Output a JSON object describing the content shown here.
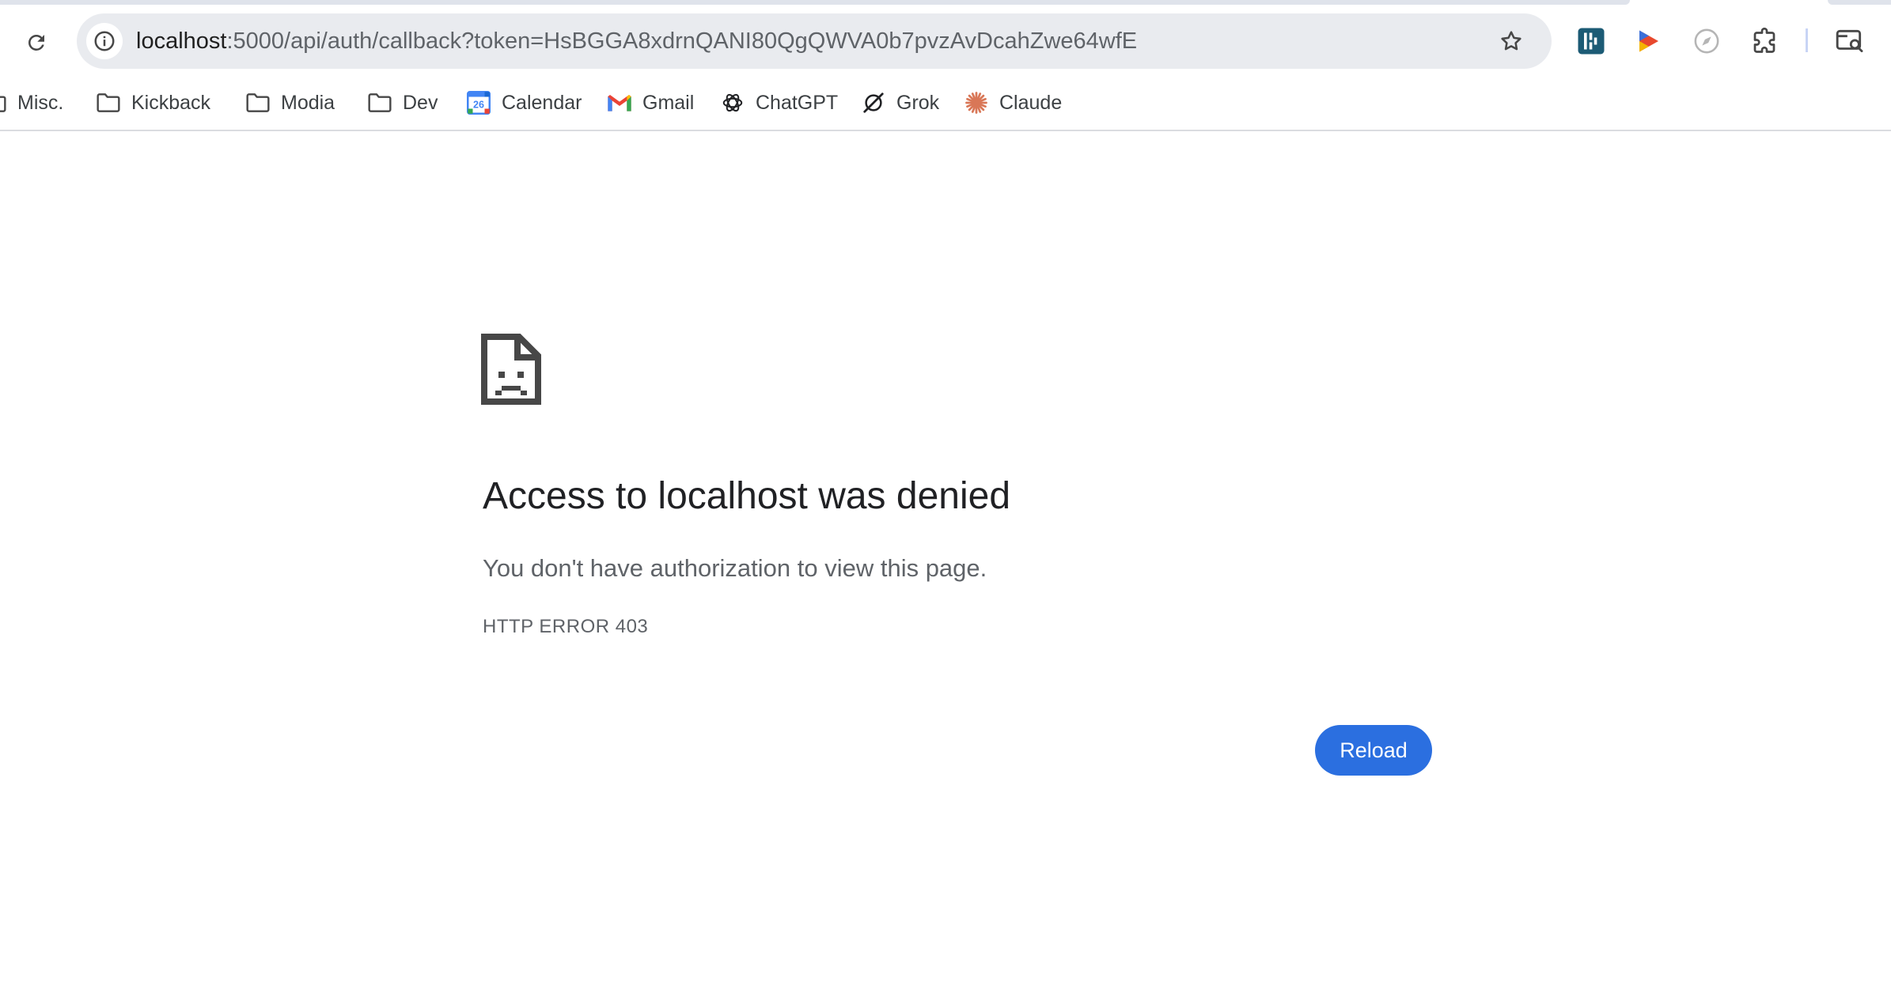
{
  "browser": {
    "address_bar": {
      "url_host": "localhost",
      "url_rest": ":5000/api/auth/callback?token=HsBGGA8xdrnQANI80QgQWVA0b7pvzAvDcahZwe64wfE"
    },
    "bookmarks": [
      {
        "label": "Misc.",
        "icon": "folder-icon"
      },
      {
        "label": "Kickback",
        "icon": "folder-icon"
      },
      {
        "label": "Modia",
        "icon": "folder-icon"
      },
      {
        "label": "Dev",
        "icon": "folder-icon"
      },
      {
        "label": "Calendar",
        "icon": "google-calendar-icon",
        "badge": "26"
      },
      {
        "label": "Gmail",
        "icon": "gmail-icon"
      },
      {
        "label": "ChatGPT",
        "icon": "chatgpt-icon"
      },
      {
        "label": "Grok",
        "icon": "grok-icon"
      },
      {
        "label": "Claude",
        "icon": "claude-icon"
      }
    ],
    "extensions": [
      "extension-teal-icon",
      "extension-play-icon",
      "extension-compass-icon",
      "extensions-puzzle-icon",
      "tab-search-icon"
    ]
  },
  "error_page": {
    "title": "Access to localhost was denied",
    "description": "You don't have authorization to view this page.",
    "code": "HTTP ERROR 403",
    "reload_label": "Reload"
  },
  "colors": {
    "accent": "#2b6fe0",
    "omnibox_bg": "#e9ebef",
    "text_primary": "#202124",
    "text_secondary": "#5f6368"
  }
}
